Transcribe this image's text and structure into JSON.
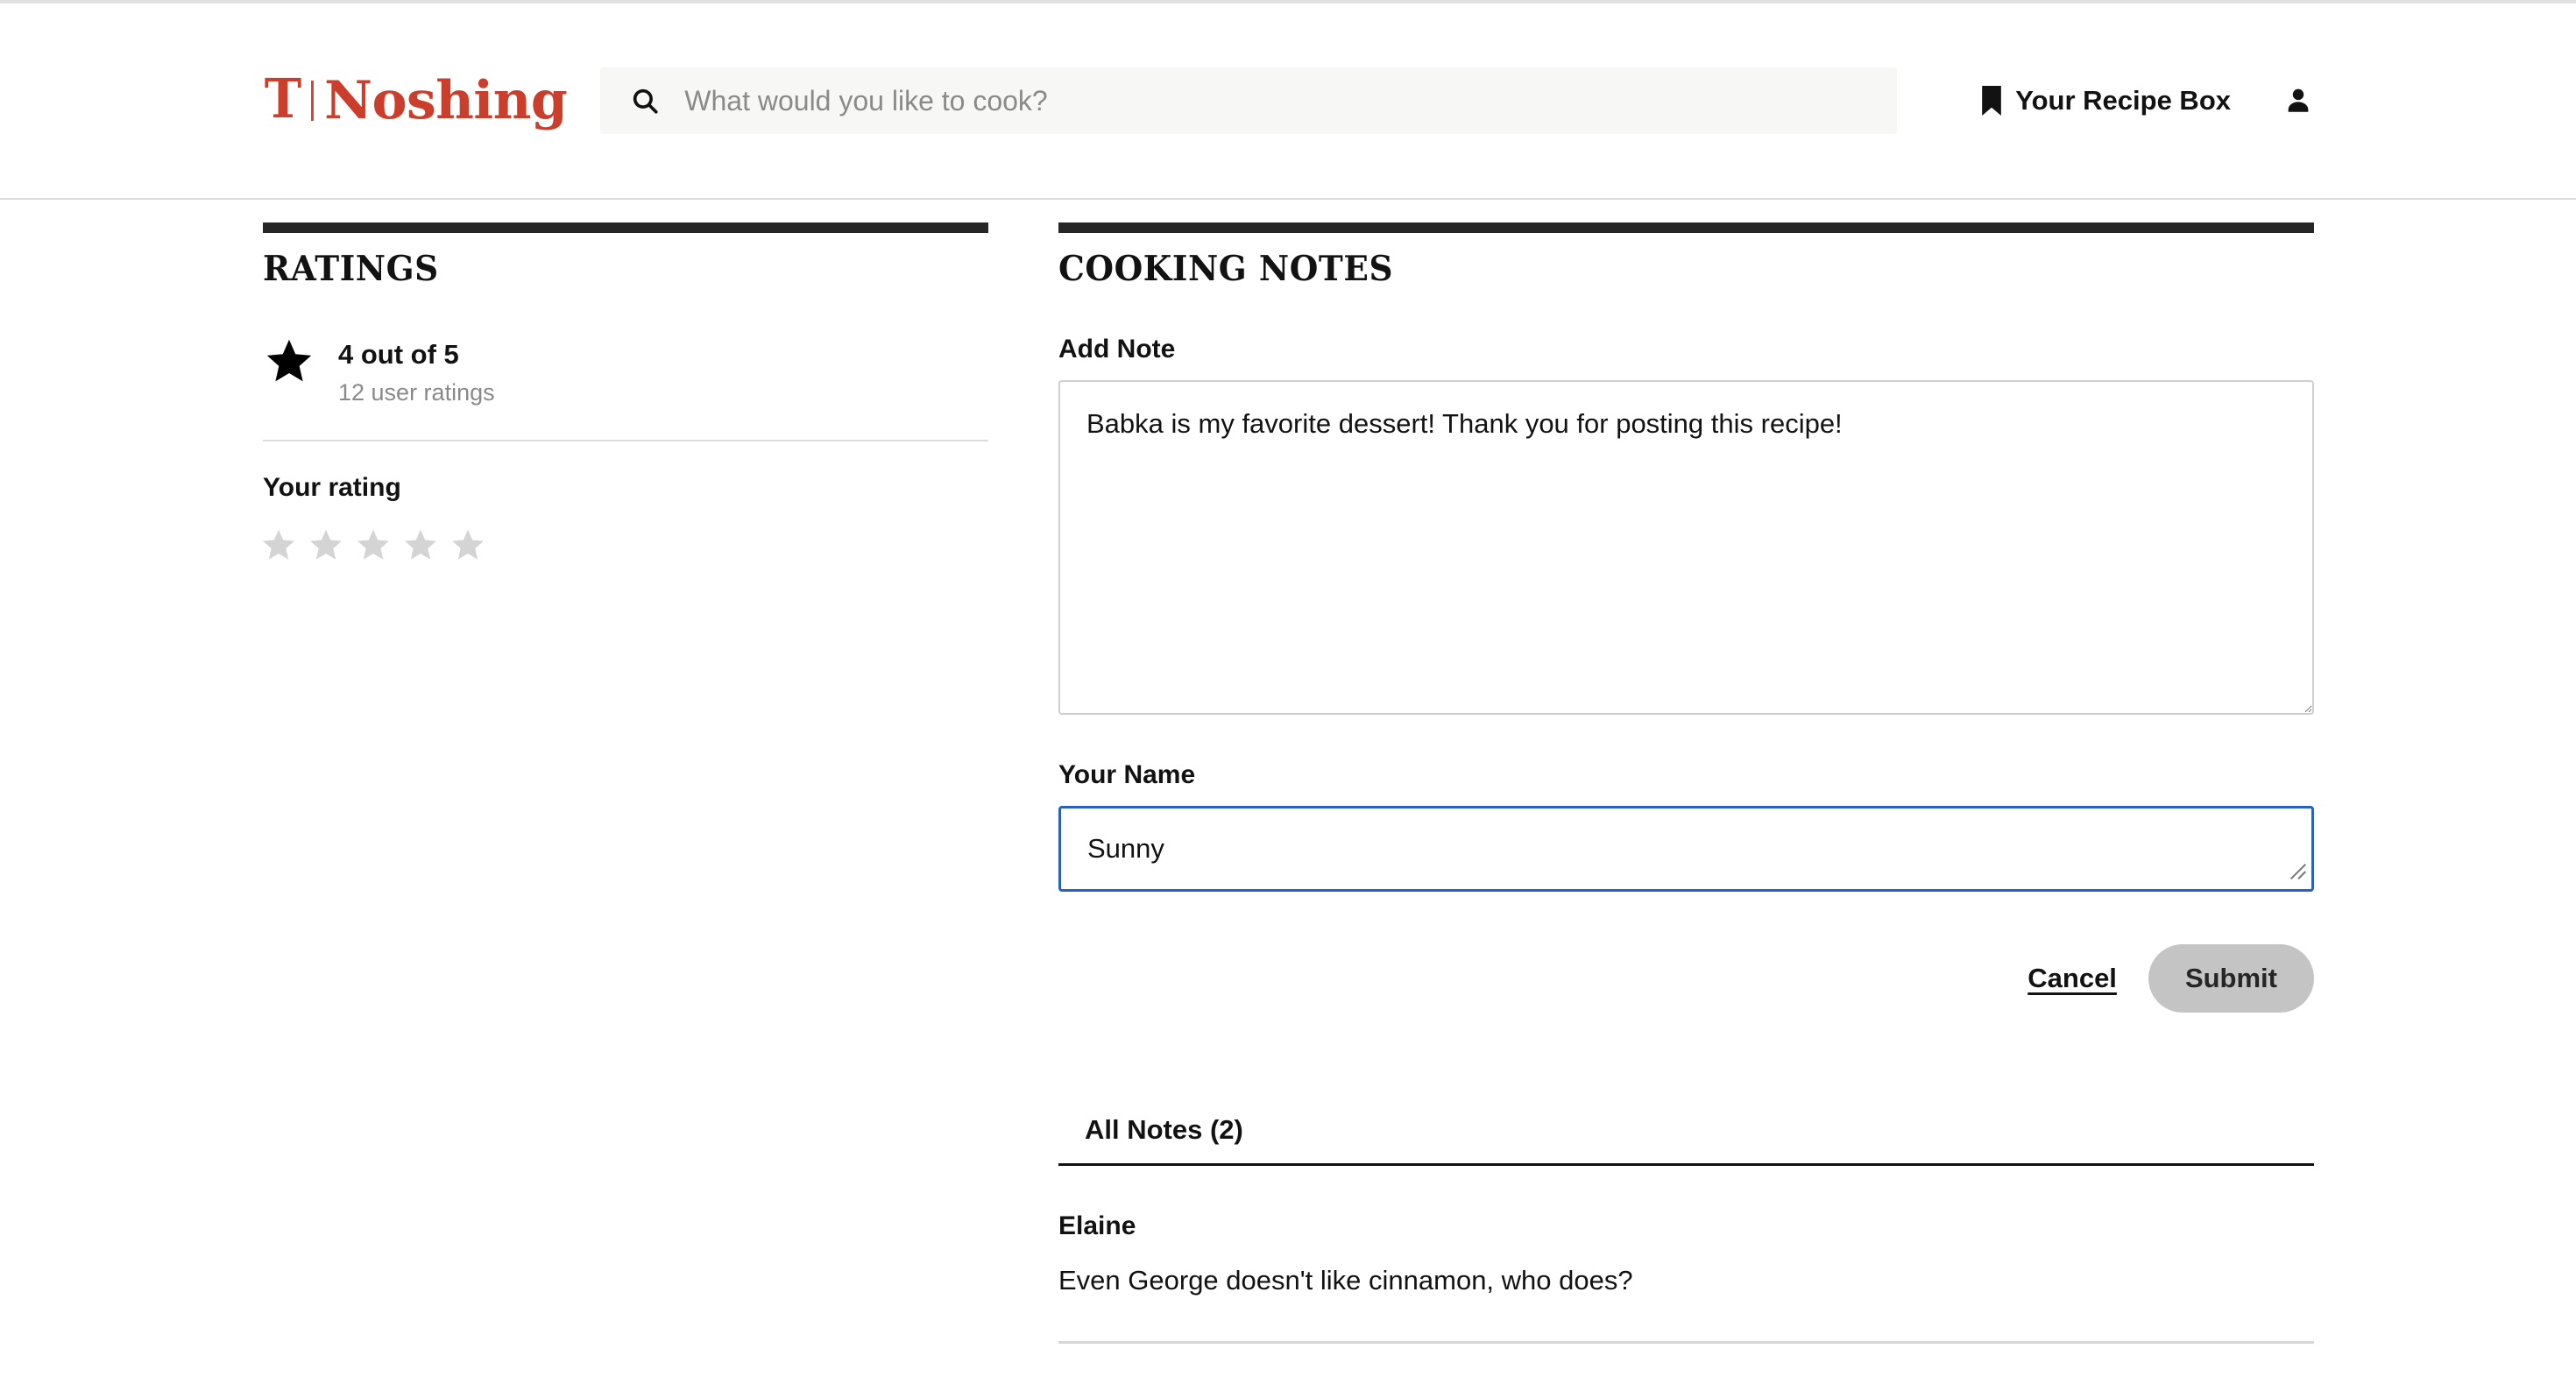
{
  "header": {
    "logo_mark": "T",
    "logo_word": "Noshing",
    "search": {
      "placeholder": "What would you like to cook?",
      "value": "",
      "icon": "search-icon"
    },
    "recipe_box_label": "Your Recipe Box",
    "recipe_box_icon": "bookmark-icon",
    "account_icon": "account-icon",
    "brand_color": "#cb3e2c"
  },
  "ratings": {
    "section_title": "RATINGS",
    "average_text": "4 out of 5",
    "average_value": 4,
    "scale_max": 5,
    "count_text": "12 user ratings",
    "your_rating_label": "Your rating",
    "your_rating_value": 0,
    "star_icon": "star-icon",
    "empty_star_color": "#d4d4d4",
    "filled_star_color": "#000000"
  },
  "cooking_notes": {
    "section_title": "COOKING NOTES",
    "add_note_label": "Add Note",
    "note_value": "Babka is my favorite dessert! Thank you for posting this recipe!",
    "note_placeholder": "",
    "your_name_label": "Your Name",
    "name_value": "Sunny",
    "name_placeholder": "",
    "name_focus_color": "#2b5fc4",
    "cancel_label": "Cancel",
    "submit_label": "Submit",
    "submit_bg": "#c4c4c4",
    "tab_label": "All Notes (2)",
    "notes_count": 2,
    "notes": [
      {
        "author": "Elaine",
        "body": "Even George doesn't like cinnamon, who does?"
      }
    ]
  }
}
